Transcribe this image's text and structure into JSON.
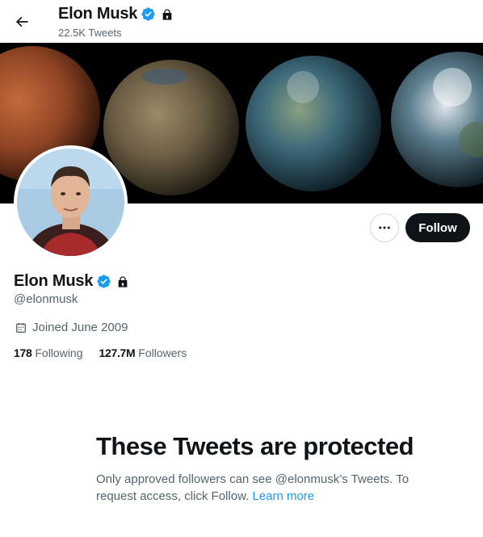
{
  "header": {
    "name": "Elon Musk",
    "tweet_count": "22.5K Tweets"
  },
  "profile": {
    "name": "Elon Musk",
    "handle": "@elonmusk",
    "joined": "Joined June 2009",
    "following_count": "178",
    "following_label": "Following",
    "followers_count": "127.7M",
    "followers_label": "Followers"
  },
  "actions": {
    "follow_label": "Follow"
  },
  "protected": {
    "heading": "These Tweets are protected",
    "body": "Only approved followers can see @elonmusk’s Tweets. To request access, click Follow.",
    "link": "Learn more"
  },
  "colors": {
    "accent": "#1d9bf0",
    "text": "#0f1419",
    "secondary": "#536471"
  },
  "icons": {
    "back": "arrow-left-icon",
    "verified": "verified-badge-icon",
    "protected": "lock-icon",
    "more": "more-dots-icon",
    "calendar": "calendar-icon"
  }
}
